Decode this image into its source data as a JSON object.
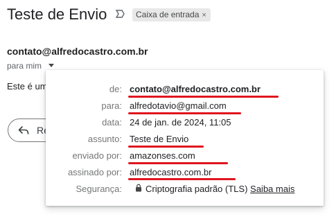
{
  "email": {
    "subject": "Teste de Envio",
    "label": "Caixa de entrada",
    "label_remove": "×",
    "sender": "contato@alfredocastro.com.br",
    "to_me": "para mim",
    "body_preview": "Este é um",
    "reply_label": "Re"
  },
  "details": {
    "from_key": "de:",
    "from_val": "contato@alfredocastro.com.br",
    "to_key": "para:",
    "to_val": "alfredotavio@gmail.com",
    "date_key": "data:",
    "date_val": "24 de jan. de 2024, 11:05",
    "subject_key": "assunto:",
    "subject_val": "Teste de Envio",
    "mailedby_key": "enviado por:",
    "mailedby_val": "amazonses.com",
    "signedby_key": "assinado por:",
    "signedby_val": "alfredocastro.com.br",
    "security_key": "Segurança:",
    "security_val": "Criptografia padrão (TLS)",
    "learn_more": "Saiba mais"
  },
  "colors": {
    "highlight": "#e0141e",
    "chip_bg": "#e8e8e8"
  },
  "icons": [
    "importance-marker-icon",
    "caret-down-icon",
    "reply-arrow-icon",
    "lock-icon"
  ]
}
